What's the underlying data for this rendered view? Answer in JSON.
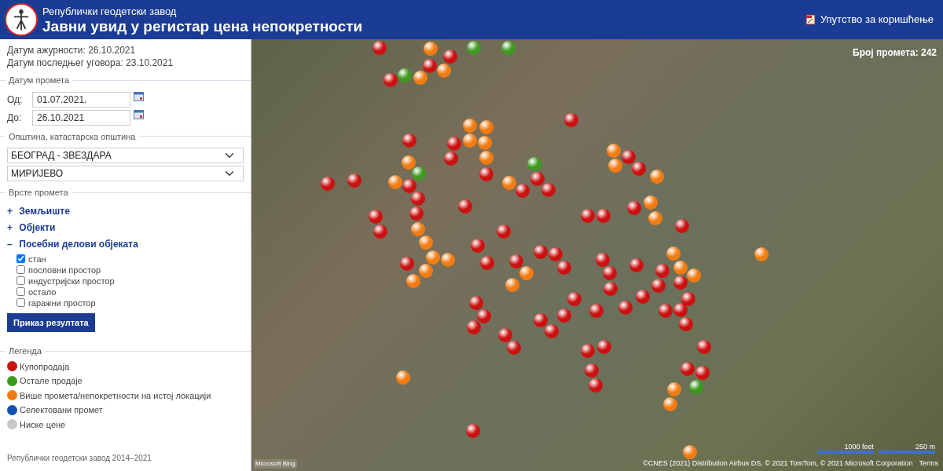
{
  "header": {
    "organization": "Републички геодетски завод",
    "title": "Јавни увид у регистар цена непокретности",
    "manual_link": "Упутство за коришћење"
  },
  "sidebar": {
    "update_date": "Датум ажурности: 26.10.2021",
    "last_contract_date": "Датум последњег уговора: 23.10.2021",
    "date_section": {
      "legend": "Датум промета",
      "from_label": "Од:",
      "from_value": "01.07.2021.",
      "to_label": "До:",
      "to_value": "26.10.2021"
    },
    "municipality_section": {
      "legend": "Општина, катастарска општина",
      "municipality": "БЕОГРАД - ЗВЕЗДАРА",
      "cadastral_municipality": "МИРИЈЕВО"
    },
    "types_section": {
      "legend": "Врсте промета",
      "groups": [
        {
          "label": "Земљиште",
          "toggle": "+"
        },
        {
          "label": "Објекти",
          "toggle": "+"
        },
        {
          "label": "Посебни делови објеката",
          "toggle": "–",
          "options": [
            {
              "label": "стан",
              "checked": true
            },
            {
              "label": "пословни простор",
              "checked": false
            },
            {
              "label": "индустријски простор",
              "checked": false
            },
            {
              "label": "остало",
              "checked": false
            },
            {
              "label": "гаражни простор",
              "checked": false
            }
          ]
        }
      ]
    },
    "submit_button": "Приказ резултата",
    "legend": {
      "title": "Легенда",
      "items": [
        {
          "label": "Купопродаја",
          "color": "#cc1111"
        },
        {
          "label": "Остале продаје",
          "color": "#3d9a1e"
        },
        {
          "label": "Више промета/непокретности на истој локацији",
          "color": "#f27c12"
        },
        {
          "label": "Селектовани промет",
          "color": "#1450b4"
        },
        {
          "label": "Ниске цене",
          "color": "#c8c8c8"
        }
      ]
    },
    "footer": "Републички геодетски завод 2014–2021"
  },
  "map": {
    "transaction_count": "Број промета: 242",
    "scale_feet": "1000 feet",
    "scale_meters": "250 m",
    "provider_logo": "Microsoft Bing",
    "attribution": "©CNES (2021) Distribution Airbus DS, © 2021 TomTom, © 2021 Microsoft Corporation",
    "terms_link": "Terms",
    "markers": [
      {
        "color": "#cc1111"
      },
      {
        "color": "#cc1111"
      },
      {
        "color": "#cc1111"
      },
      {
        "color": "#cc1111"
      },
      {
        "color": "#cc1111"
      },
      {
        "color": "#cc1111"
      },
      {
        "color": "#cc1111"
      },
      {
        "color": "#cc1111"
      },
      {
        "color": "#cc1111"
      },
      {
        "color": "#cc1111"
      },
      {
        "color": "#cc1111"
      },
      {
        "color": "#cc1111"
      },
      {
        "color": "#cc1111"
      },
      {
        "color": "#cc1111"
      },
      {
        "color": "#cc1111"
      },
      {
        "color": "#cc1111"
      },
      {
        "color": "#cc1111"
      },
      {
        "color": "#cc1111"
      },
      {
        "color": "#cc1111"
      },
      {
        "color": "#cc1111"
      },
      {
        "color": "#cc1111"
      },
      {
        "color": "#cc1111"
      },
      {
        "color": "#cc1111"
      },
      {
        "color": "#cc1111"
      },
      {
        "color": "#cc1111"
      },
      {
        "color": "#cc1111"
      },
      {
        "color": "#cc1111"
      },
      {
        "color": "#cc1111"
      },
      {
        "color": "#cc1111"
      },
      {
        "color": "#cc1111"
      },
      {
        "color": "#cc1111"
      },
      {
        "color": "#cc1111"
      },
      {
        "color": "#cc1111"
      },
      {
        "color": "#cc1111"
      },
      {
        "color": "#cc1111"
      },
      {
        "color": "#cc1111"
      },
      {
        "color": "#cc1111"
      },
      {
        "color": "#cc1111"
      },
      {
        "color": "#cc1111"
      },
      {
        "color": "#cc1111"
      },
      {
        "color": "#cc1111"
      },
      {
        "color": "#cc1111"
      },
      {
        "color": "#cc1111"
      },
      {
        "color": "#cc1111"
      },
      {
        "color": "#cc1111"
      },
      {
        "color": "#cc1111"
      },
      {
        "color": "#cc1111"
      },
      {
        "color": "#cc1111"
      },
      {
        "color": "#cc1111"
      },
      {
        "color": "#cc1111"
      },
      {
        "color": "#cc1111"
      },
      {
        "color": "#cc1111"
      },
      {
        "color": "#cc1111"
      },
      {
        "color": "#cc1111"
      },
      {
        "color": "#cc1111"
      },
      {
        "color": "#cc1111"
      },
      {
        "color": "#cc1111"
      },
      {
        "color": "#cc1111"
      },
      {
        "color": "#cc1111"
      },
      {
        "color": "#cc1111"
      },
      {
        "color": "#cc1111"
      },
      {
        "color": "#cc1111"
      },
      {
        "color": "#cc1111"
      },
      {
        "color": "#cc1111"
      },
      {
        "color": "#cc1111"
      },
      {
        "color": "#f27c12"
      },
      {
        "color": "#f27c12"
      },
      {
        "color": "#f27c12"
      },
      {
        "color": "#f27c12"
      },
      {
        "color": "#f27c12"
      },
      {
        "color": "#f27c12"
      },
      {
        "color": "#f27c12"
      },
      {
        "color": "#f27c12"
      },
      {
        "color": "#f27c12"
      },
      {
        "color": "#f27c12"
      },
      {
        "color": "#f27c12"
      },
      {
        "color": "#f27c12"
      },
      {
        "color": "#f27c12"
      },
      {
        "color": "#f27c12"
      },
      {
        "color": "#f27c12"
      },
      {
        "color": "#f27c12"
      },
      {
        "color": "#f27c12"
      },
      {
        "color": "#f27c12"
      },
      {
        "color": "#f27c12"
      },
      {
        "color": "#f27c12"
      },
      {
        "color": "#f27c12"
      },
      {
        "color": "#f27c12"
      },
      {
        "color": "#f27c12"
      },
      {
        "color": "#f27c12"
      },
      {
        "color": "#f27c12"
      },
      {
        "color": "#f27c12"
      },
      {
        "color": "#f27c12"
      },
      {
        "color": "#f27c12"
      },
      {
        "color": "#f27c12"
      },
      {
        "color": "#f27c12"
      },
      {
        "color": "#f27c12"
      },
      {
        "color": "#f27c12"
      },
      {
        "color": "#3d9a1e"
      },
      {
        "color": "#3d9a1e"
      },
      {
        "color": "#3d9a1e"
      },
      {
        "color": "#3d9a1e"
      },
      {
        "color": "#3d9a1e"
      },
      {
        "color": "#3d9a1e"
      }
    ]
  }
}
